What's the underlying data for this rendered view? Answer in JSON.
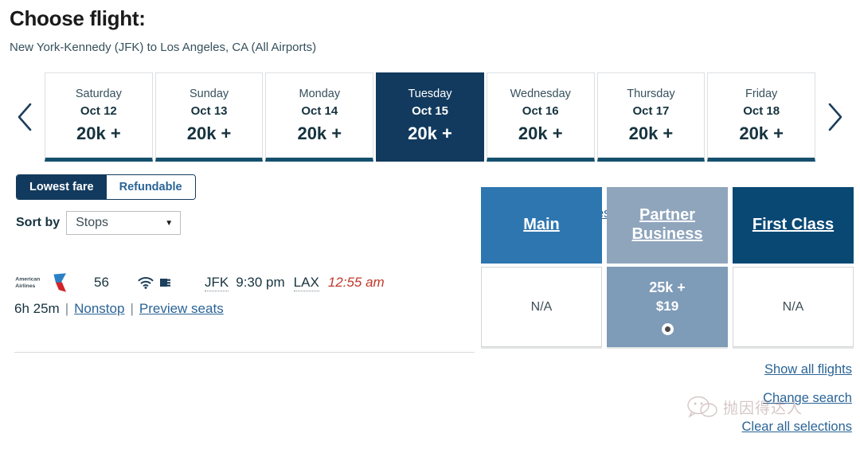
{
  "header": {
    "title": "Choose flight:",
    "route": "New York-Kennedy (JFK) to Los Angeles, CA (All Airports)"
  },
  "date_strip": {
    "prev_icon": "chevron-left-icon",
    "next_icon": "chevron-right-icon",
    "dates": [
      {
        "dow": "Saturday",
        "date": "Oct 12",
        "miles": "20k +",
        "selected": false
      },
      {
        "dow": "Sunday",
        "date": "Oct 13",
        "miles": "20k +",
        "selected": false
      },
      {
        "dow": "Monday",
        "date": "Oct 14",
        "miles": "20k +",
        "selected": false
      },
      {
        "dow": "Tuesday",
        "date": "Oct 15",
        "miles": "20k +",
        "selected": true
      },
      {
        "dow": "Wednesday",
        "date": "Oct 16",
        "miles": "20k +",
        "selected": false
      },
      {
        "dow": "Thursday",
        "date": "Oct 17",
        "miles": "20k +",
        "selected": false
      },
      {
        "dow": "Friday",
        "date": "Oct 18",
        "miles": "20k +",
        "selected": false
      }
    ]
  },
  "filters": {
    "toggle": {
      "lowest_fare": "Lowest fare",
      "refundable": "Refundable",
      "active": "Lowest fare"
    },
    "sort": {
      "label": "Sort by",
      "value": "Stops",
      "caret_icon": "caret-down-icon"
    },
    "compare_link": "Compare award types"
  },
  "cabins": [
    {
      "name": "Main",
      "color": "#2e76b0"
    },
    {
      "name": "Partner Business",
      "color": "#8fa5bc"
    },
    {
      "name": "First Class",
      "color": "#0a4874"
    }
  ],
  "flight": {
    "airline": "American Airlines",
    "airline_logo": "american-airlines-logo",
    "flight_number": "56",
    "amenities": [
      "wifi-icon",
      "power-outlet-icon"
    ],
    "depart_airport": "JFK",
    "depart_time": "9:30 pm",
    "arrive_airport": "LAX",
    "arrive_time": "12:55 am",
    "duration": "6h 25m",
    "stops": "Nonstop",
    "preview_seats": "Preview seats",
    "separator": "|",
    "fares": [
      {
        "cabin": "Main",
        "value": "N/A",
        "cash": "",
        "selected": false
      },
      {
        "cabin": "Partner Business",
        "value": "25k +",
        "cash": "$19",
        "selected": true
      },
      {
        "cabin": "First Class",
        "value": "N/A",
        "cash": "",
        "selected": false
      }
    ]
  },
  "bottom_links": [
    {
      "label": "Show all flights"
    },
    {
      "label": "Change search"
    },
    {
      "label": "Clear all selections"
    }
  ],
  "watermark": {
    "icon": "wechat-icon",
    "text": "抛因得达人"
  },
  "colors": {
    "navy": "#123a5e",
    "link": "#2a6496",
    "selected_fare": "#7e9bb8",
    "arrival_red": "#c0392b"
  }
}
